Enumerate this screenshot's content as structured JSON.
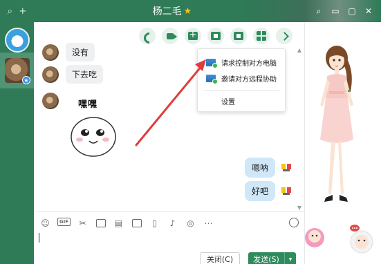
{
  "window": {
    "title": "杨二毛",
    "title_star": "★",
    "controls": [
      "⌕",
      "▭",
      "▢",
      "✕"
    ]
  },
  "left_bar": {
    "search_icon": "⌕",
    "add_icon": "+"
  },
  "toolbar": {
    "icons": [
      "phone-icon",
      "video-icon",
      "add-icon",
      "screen-share-icon",
      "remote-desktop-icon",
      "apps-icon",
      "more-icon"
    ]
  },
  "messages": [
    {
      "from": "other",
      "text": "没有"
    },
    {
      "from": "other",
      "text": "下去吃"
    },
    {
      "from": "other",
      "sticker": true,
      "text": "嘿嘿"
    },
    {
      "from": "self",
      "text": "嗯呐"
    },
    {
      "from": "self",
      "text": "好吧"
    }
  ],
  "menu": {
    "items": [
      {
        "label": "请求控制对方电脑"
      },
      {
        "label": "邀请对方远程协助"
      },
      {
        "label": "设置"
      }
    ]
  },
  "input": {
    "icons": [
      "emoji-icon",
      "gif-icon",
      "scissors-icon",
      "folder-icon",
      "image-text-icon",
      "image-icon",
      "shake-icon",
      "voice-icon",
      "red-packet-icon",
      "more-icon"
    ],
    "gif_label": "GIF",
    "close_label": "关闭(C)",
    "send_label": "发送(S)",
    "send_arrow": "▾"
  },
  "colors": {
    "brand": "#2f7a57",
    "accent": "#2f8a5c",
    "bubble_out": "#cfe7f7",
    "bubble_in": "#eef0f2",
    "arrow": "#e03c3c"
  }
}
